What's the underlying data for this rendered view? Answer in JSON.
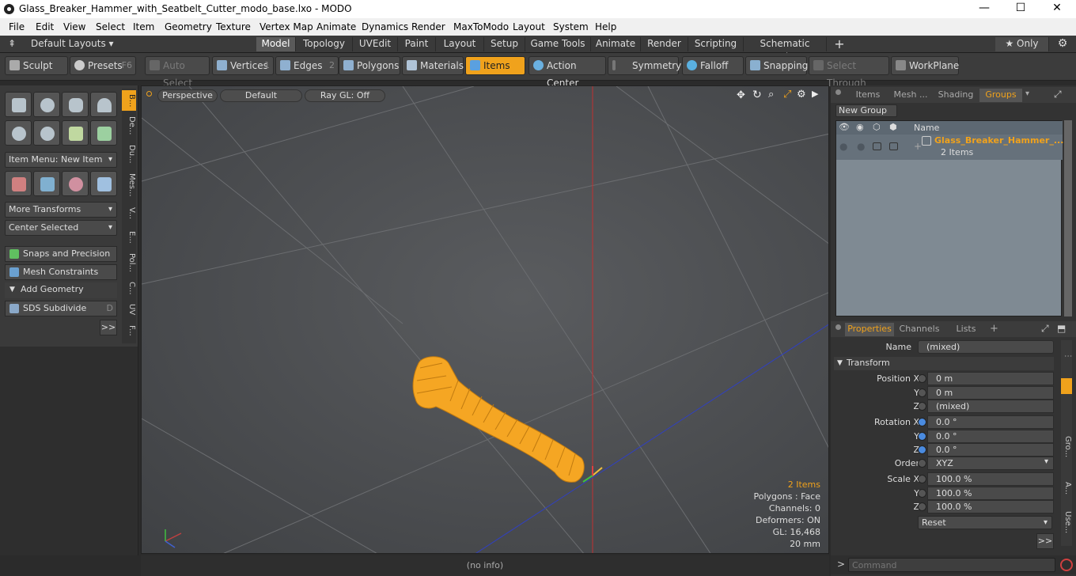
{
  "window": {
    "title": "Glass_Breaker_Hammer_with_Seatbelt_Cutter_modo_base.lxo - MODO",
    "minimize": "—",
    "maximize": "☐",
    "close": "✕"
  },
  "menu": [
    "File",
    "Edit",
    "View",
    "Select",
    "Item",
    "Geometry",
    "Texture",
    "Vertex Map",
    "Animate",
    "Dynamics",
    "Render",
    "MaxToModo",
    "Layout",
    "System",
    "Help"
  ],
  "layouts": {
    "default": "Default Layouts ▾",
    "tabs": [
      "Model",
      "Topology",
      "UVEdit",
      "Paint",
      "Layout",
      "Setup",
      "Game Tools",
      "Animate",
      "Render",
      "Scripting",
      "Schematic Fusion"
    ],
    "active": "Model",
    "add": "+",
    "only": "★  Only",
    "gear": "⚙"
  },
  "toolbar": {
    "sculpt": "Sculpt",
    "presets": "Presets",
    "presets_key": "F6",
    "auto_select": "Auto Select",
    "vertices": "Vertices",
    "vertices_key": "1",
    "edges": "Edges",
    "edges_key": "2",
    "polygons": "Polygons",
    "materials": "Materials",
    "items": "Items",
    "action_center": "Action Center",
    "symmetry": "Symmetry",
    "falloff": "Falloff",
    "snapping": "Snapping",
    "select_through": "Select Through",
    "workplane": "WorkPlane"
  },
  "left": {
    "item_menu": "Item Menu: New Item",
    "more_transforms": "More Transforms",
    "center_selected": "Center Selected",
    "snaps": "Snaps and Precision",
    "mesh_constraints": "Mesh Constraints",
    "add_geometry": "Add Geometry",
    "sds": "SDS Subdivide",
    "sds_key": "D",
    "more": ">>",
    "tabs": [
      "B...",
      "De...",
      "Du...",
      "Mes...",
      "V...",
      "E...",
      "Pol...",
      "C...",
      "UV",
      "F..."
    ]
  },
  "viewport": {
    "perspective": "Perspective",
    "default": "Default",
    "raygl": "Ray GL: Off",
    "info": [
      "2 Items",
      "Polygons : Face",
      "Channels: 0",
      "Deformers: ON",
      "GL: 16,468",
      "20 mm"
    ]
  },
  "status": "(no info)",
  "groups_panel": {
    "tabs": [
      "Items",
      "Mesh ...",
      "Shading",
      "Groups"
    ],
    "active": "Groups",
    "new_group": "New Group",
    "name_header": "Name",
    "item_name": "Glass_Breaker_Hammer_...",
    "item_count": "2 Items"
  },
  "properties": {
    "tabs": [
      "Properties",
      "Channels",
      "Lists"
    ],
    "active": "Properties",
    "add": "+",
    "name_label": "Name",
    "name_value": "(mixed)",
    "transform": "Transform",
    "rows": [
      {
        "label": "Position X",
        "value": "0 m"
      },
      {
        "label": "Y",
        "value": "0 m"
      },
      {
        "label": "Z",
        "value": "(mixed)"
      },
      {
        "label": "Rotation X",
        "value": "0.0 °"
      },
      {
        "label": "Y",
        "value": "0.0 °"
      },
      {
        "label": "Z",
        "value": "0.0 °"
      },
      {
        "label": "Order",
        "value": "XYZ"
      },
      {
        "label": "Scale X",
        "value": "100.0 %"
      },
      {
        "label": "Y",
        "value": "100.0 %"
      },
      {
        "label": "Z",
        "value": "100.0 %"
      }
    ],
    "reset": "Reset",
    "more": ">>",
    "side_tabs": [
      "Gro...",
      "A...",
      "Use..."
    ]
  },
  "command": {
    "prompt": ">",
    "placeholder": "Command"
  },
  "colors": {
    "accent": "#f0a21c",
    "viewport": "#4a4c4f"
  }
}
